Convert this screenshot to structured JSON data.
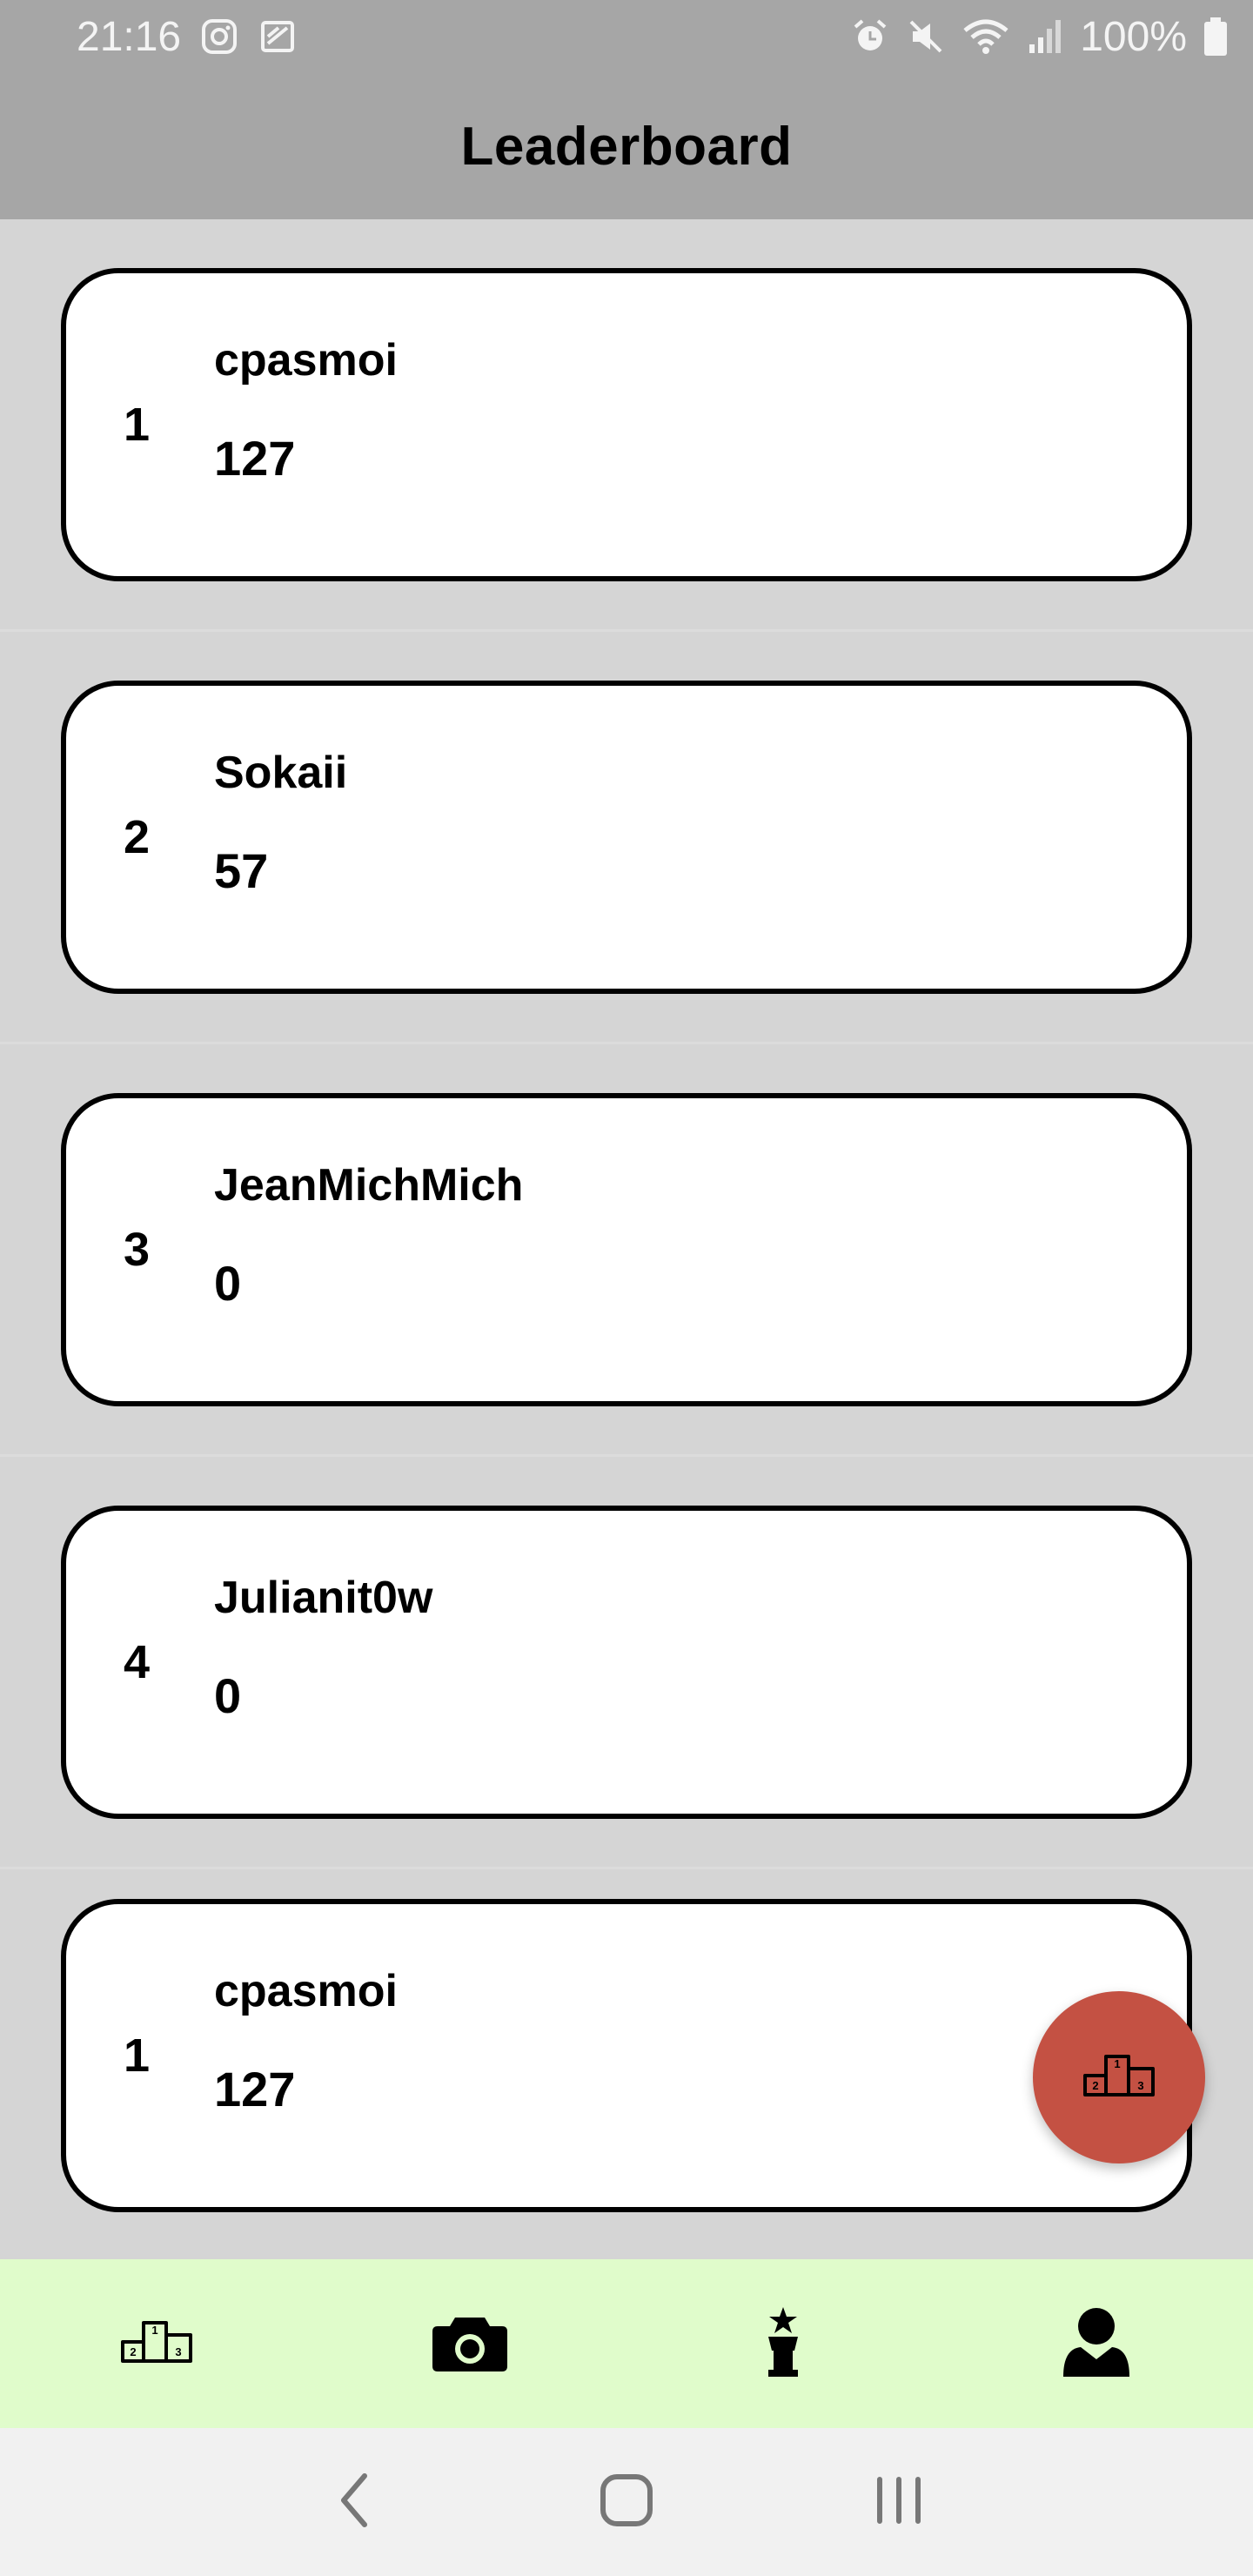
{
  "status_bar": {
    "time": "21:16",
    "battery": "100%"
  },
  "header": {
    "title": "Leaderboard"
  },
  "leaderboard": [
    {
      "rank": "1",
      "name": "cpasmoi",
      "score": "127"
    },
    {
      "rank": "2",
      "name": "Sokaii",
      "score": "57"
    },
    {
      "rank": "3",
      "name": "JeanMichMich",
      "score": "0"
    },
    {
      "rank": "4",
      "name": "Julianit0w",
      "score": "0"
    },
    {
      "rank": "1",
      "name": "cpasmoi",
      "score": "127"
    }
  ],
  "fab": {
    "icon": "podium-icon",
    "color": "#c45143"
  },
  "bottom_nav": {
    "items": [
      {
        "icon": "podium-icon"
      },
      {
        "icon": "camera-icon"
      },
      {
        "icon": "trophy-icon"
      },
      {
        "icon": "user-icon"
      }
    ],
    "background": "#e0fccb"
  },
  "colors": {
    "header_bg": "#a6a6a6",
    "list_bg": "#d5d5d5",
    "card_bg": "#ffffff"
  }
}
